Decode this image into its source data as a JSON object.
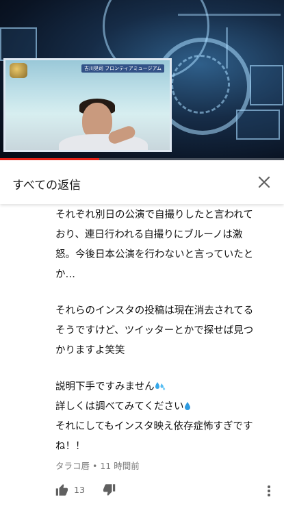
{
  "video": {
    "inset_caption": "吉川晃司 フロンティアミュージアム",
    "progress_fraction": 0.35,
    "accent_color": "#e62117"
  },
  "header": {
    "title": "すべての返信",
    "close_icon": "close-icon"
  },
  "comment": {
    "paragraph1": [
      "それぞれ別日の公演で自撮りしたと言われて",
      "おり、連日行われる自撮りにブルーノは激",
      "怒。今後日本公演を行わないと言っていたと",
      "か…"
    ],
    "paragraph2": [
      "それらのインスタの投稿は現在消去されてる",
      "そうですけど、ツイッターとかで探せば見つ",
      "かりますよ笑笑"
    ],
    "paragraph3_line1": "説明下手ですみません",
    "paragraph3_line2": "詳しくは調べてみてください",
    "paragraph3_line3": "それにしてもインスタ映え依存症怖すぎです",
    "paragraph3_line4": "ね！！",
    "author": "タラコ唇",
    "separator": "•",
    "time": "11 時間前",
    "like_count": "13",
    "icons": [
      "sweat-drops-icon",
      "droplet-icon",
      "thumbs-up-icon",
      "thumbs-down-icon",
      "more-vert-icon"
    ]
  }
}
